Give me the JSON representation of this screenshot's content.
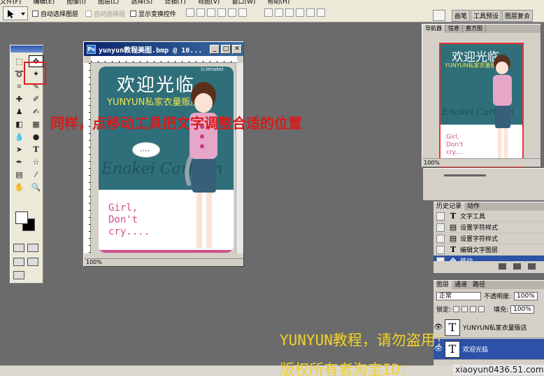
{
  "menubar": {
    "items": [
      "文件(F)",
      "编辑(E)",
      "图像(I)",
      "图层(L)",
      "选择(S)",
      "滤镜(T)",
      "视图(V)",
      "窗口(W)",
      "帮助(H)"
    ]
  },
  "options": {
    "auto_select_layer": "自动选择图层",
    "auto_select_group": "自动选择组",
    "show_transform": "显示变换控件",
    "palette_tabs": [
      "画笔",
      "工具预设",
      "图层复合"
    ]
  },
  "document": {
    "title": "yunyun教程美图.bmp @ 10...",
    "zoom": "100%",
    "art": {
      "heading": "欢迎光临",
      "shop": "YUNYUN私家衣量贩店",
      "copyright": "(c)enakei",
      "bubble": "....",
      "script_word": "Enakei Cartoon",
      "girl_text": "Girl, Don't cry...."
    }
  },
  "navigator": {
    "tabs": [
      "导航器",
      "信息",
      "直方图"
    ],
    "zoom": "100%"
  },
  "history": {
    "tabs": [
      "历史记录",
      "动作"
    ],
    "items": [
      {
        "icon": "text-tool-icon",
        "label": "文字工具"
      },
      {
        "icon": "style-icon",
        "label": "设置字符样式"
      },
      {
        "icon": "style-icon",
        "label": "设置字符样式"
      },
      {
        "icon": "text-layer-icon",
        "label": "编辑文字图层"
      },
      {
        "icon": "move-icon",
        "label": "移动"
      }
    ]
  },
  "layers": {
    "tabs": [
      "图层",
      "通道",
      "路径"
    ],
    "blend_mode": "正常",
    "opacity_label": "不透明度:",
    "opacity": "100%",
    "lock_label": "锁定:",
    "fill_label": "填充:",
    "fill": "100%",
    "items": [
      {
        "name": "YUNYUN私家衣量贩店",
        "thumb": "T"
      },
      {
        "name": "欢迎光临",
        "thumb": "T"
      }
    ]
  },
  "overlay": {
    "instruction": "同样，点移动工具把文字调整合适的位置",
    "watermark_line1": "YUNYUN教程，请勿盗用！",
    "watermark_line2": "版权所有者淘宝ID：",
    "site": "xiaoyun0436.51.com"
  },
  "colors": {
    "accent_red": "#e02020",
    "teal": "#2f6f7a",
    "watermark": "#f2d22a",
    "selected": "#2b52a8"
  }
}
